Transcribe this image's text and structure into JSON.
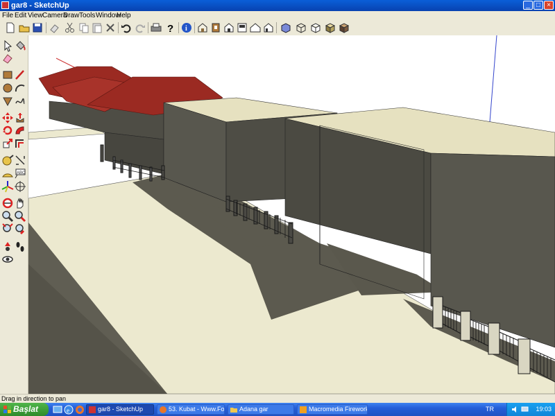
{
  "window": {
    "title": "gar8 - SketchUp"
  },
  "menu": {
    "items": [
      "File",
      "Edit",
      "View",
      "Camera",
      "Draw",
      "Tools",
      "Window",
      "Help"
    ]
  },
  "toolbar": {
    "icons": [
      "new-icon",
      "open-icon",
      "save-icon",
      "erase-icon",
      "cut-icon",
      "copy-icon",
      "paste-icon",
      "delete-icon",
      "undo-icon",
      "redo-icon",
      "print-icon",
      "help-icon",
      "model-info-icon",
      "iso-view-icon",
      "top-view-icon",
      "front-view-icon",
      "right-view-icon",
      "back-view-icon",
      "left-view-icon",
      "xray-icon",
      "wireframe-icon",
      "hidden-line-icon",
      "shaded-icon",
      "textured-icon"
    ]
  },
  "left_toolbar": {
    "icons": [
      "select-icon",
      "paint-bucket-icon",
      "eraser-icon",
      "rectangle-icon",
      "line-icon",
      "circle-icon",
      "arc-icon",
      "polygon-icon",
      "freehand-icon",
      "move-icon",
      "push-pull-icon",
      "rotate-icon",
      "follow-me-icon",
      "scale-icon",
      "offset-icon",
      "tape-measure-icon",
      "dimension-icon",
      "protractor-icon",
      "text-icon",
      "axes-icon",
      "3d-text-icon",
      "orbit-icon",
      "pan-icon",
      "zoom-icon",
      "zoom-window-icon",
      "zoom-extents-icon",
      "previous-view-icon",
      "position-camera-icon",
      "walk-icon",
      "look-around-icon"
    ]
  },
  "status": {
    "text": "Drag in direction to pan"
  },
  "taskbar": {
    "start_label": "Başlat",
    "tasks": [
      {
        "label": "gar8 - SketchUp",
        "active": true
      },
      {
        "label": "53. Kubat - Www.Fos..."
      },
      {
        "label": "Adana gar"
      },
      {
        "label": "Macromedia Fireworks 8"
      }
    ],
    "language": "TR",
    "clock": "19:03"
  },
  "colors": {
    "roof": "#9b2a22",
    "wall": "#4e4d45",
    "ground": "#ece9cf",
    "shadow": "#5c5a4f",
    "axis_blue": "#3344cc",
    "axis_red": "#cc3333"
  }
}
